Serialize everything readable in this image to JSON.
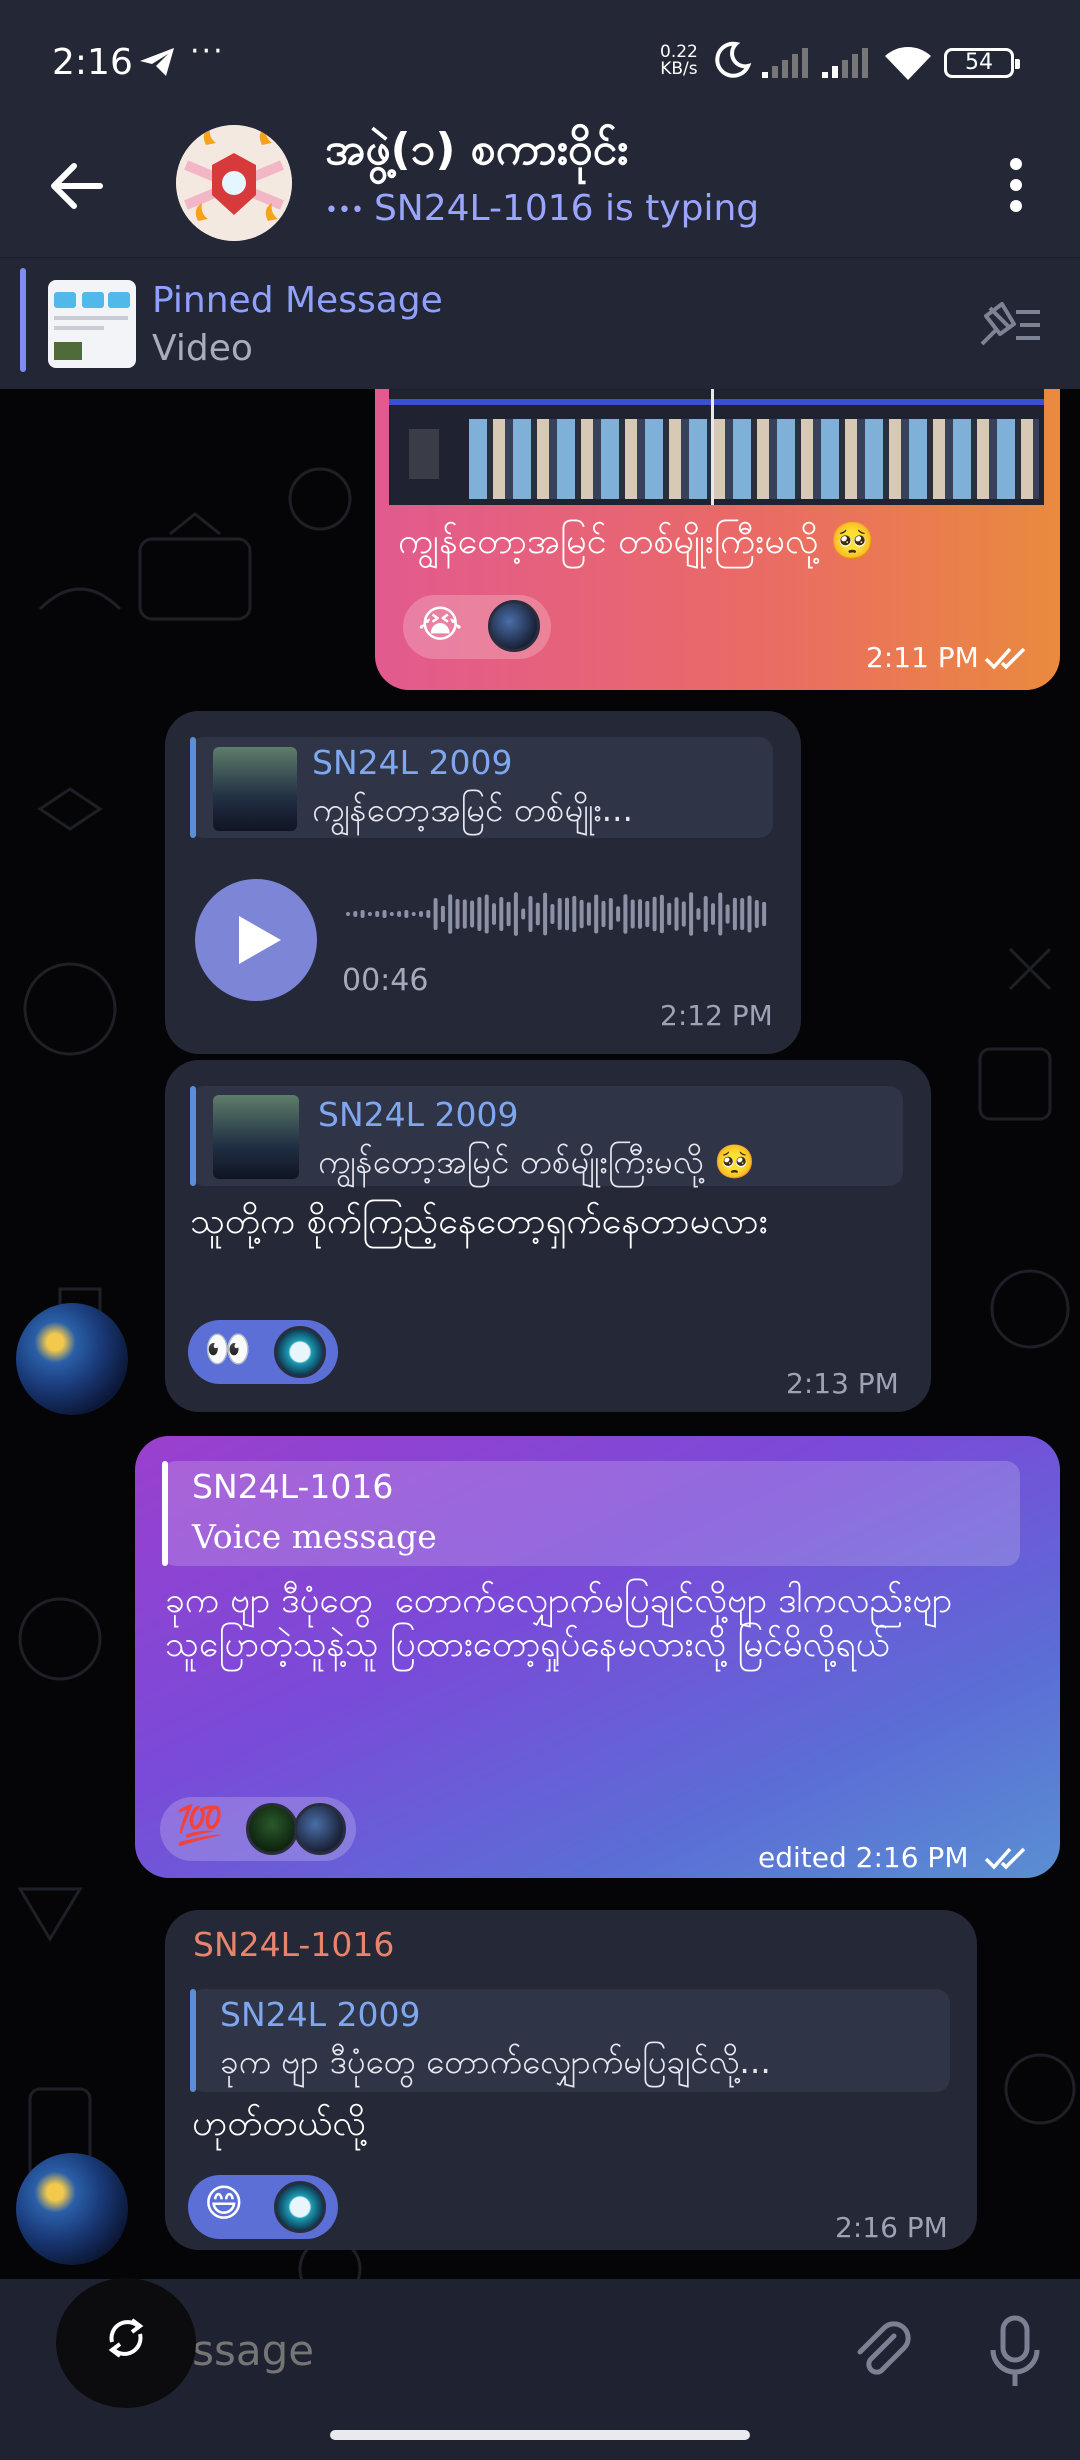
{
  "status_bar": {
    "time": "2:16",
    "dots": "···",
    "net_speed_value": "0.22",
    "net_speed_unit": "KB/s",
    "battery": "54"
  },
  "header": {
    "title": "အဖွဲ့(၁) စကားဝိုင်း",
    "typing_dots": "•••",
    "typing": "SN24L-1016 is typing"
  },
  "pinned": {
    "title": "Pinned Message",
    "subtitle": "Video"
  },
  "messages": [
    {
      "caption": "ကျွန်တော့အမြင် တစ်မျိုးကြီးမလို့ 🥺",
      "reaction_emoji": "😭",
      "time": "2:11 PM"
    },
    {
      "reply_name": "SN24L 2009",
      "reply_text": "ကျွန်တော့အမြင် တစ်မျိုး...",
      "duration": "00:46",
      "time": "2:12 PM"
    },
    {
      "reply_name": "SN24L 2009",
      "reply_text": "ကျွန်တော့အမြင် တစ်မျိုးကြီးမလို့ 🥺",
      "text": "သူတို့က စိုက်ကြည့်နေတော့ရှက်နေတာမလား",
      "reaction_emoji": "👀",
      "time": "2:13 PM"
    },
    {
      "reply_name": "SN24L-1016",
      "reply_text": "Voice message",
      "text": "ခုက ဗျာ ဒီပုံတွေ  တောက်လျှောက်မပြချင်လို့ဗျာ ဒါကလည်းဗျာ\nသူပြောတဲ့သူနဲ့သူ ပြထားတော့ရှုပ်နေမလားလို့ မြင်မိလို့ရယ်",
      "reaction_emoji": "💯",
      "time": "edited 2:16 PM"
    },
    {
      "sender": "SN24L-1016",
      "reply_name": "SN24L 2009",
      "reply_text": "ခုက ဗျာ ဒီပုံတွေ  တောက်လျှောက်မပြချင်လို့...",
      "text": "ဟုတ်တယ်လို့",
      "reaction_emoji": "😄",
      "time": "2:16 PM"
    }
  ],
  "composer": {
    "placeholder": "Message"
  },
  "colors": {
    "accent": "#8fa0ff",
    "incoming_bubble": "#252837",
    "header_bg": "#242836",
    "sender_name": "#e8846b"
  },
  "icons": [
    "back-arrow-icon",
    "more-vert-icon",
    "pin-list-icon",
    "play-icon",
    "attach-icon",
    "mic-icon",
    "scroll-swap-icon",
    "send-icon",
    "moon-icon",
    "signal-icon",
    "wifi-icon",
    "battery-icon"
  ]
}
